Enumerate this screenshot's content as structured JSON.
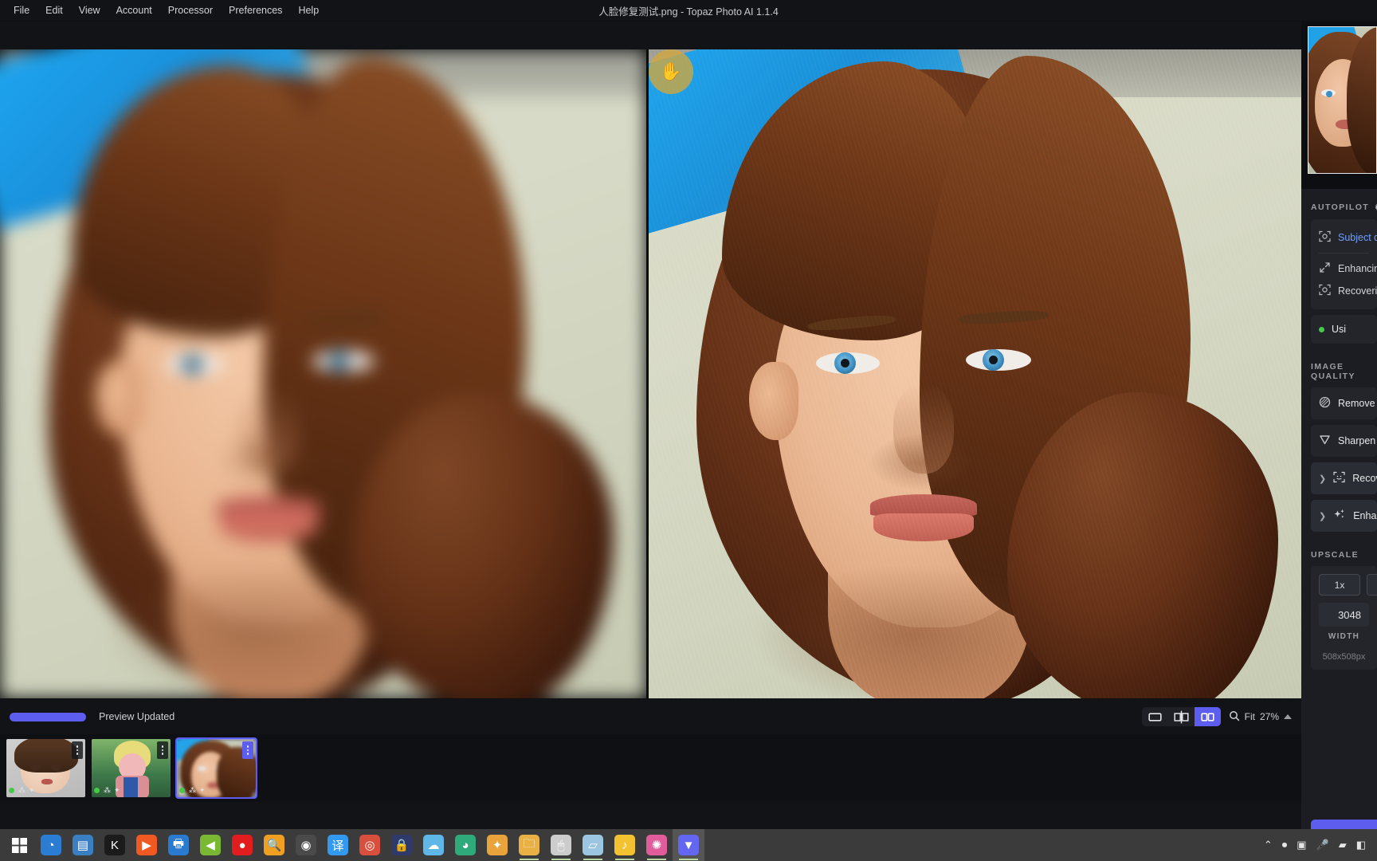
{
  "window": {
    "title": "人脸修复测试.png - Topaz Photo AI 1.1.4",
    "menus": [
      {
        "label": "File"
      },
      {
        "label": "Edit"
      },
      {
        "label": "View"
      },
      {
        "label": "Account"
      },
      {
        "label": "Processor"
      },
      {
        "label": "Preferences"
      },
      {
        "label": "Help"
      }
    ]
  },
  "sidebar": {
    "autopilot": {
      "title": "AUTOPILOT",
      "gear_icon": "gear-icon",
      "rows": [
        {
          "icon": "subject-detect-icon",
          "label": "Subject dete",
          "accent": true
        },
        {
          "icon": "enhance-arrows-icon",
          "label": "Enhancing r",
          "accent": false
        },
        {
          "icon": "face-recover-icon",
          "label": "Recovering",
          "accent": false
        }
      ],
      "status": {
        "dot": "green",
        "label": "Usi"
      }
    },
    "image_quality": {
      "title": "IMAGE QUALITY",
      "items": [
        {
          "icon": "remove-noise-icon",
          "label": "Remove No",
          "expandable": false
        },
        {
          "icon": "sharpen-icon",
          "label": "Sharpen",
          "expandable": false
        },
        {
          "icon": "recover-faces-icon",
          "label": "Recover",
          "expandable": true
        },
        {
          "icon": "enhance-icon",
          "label": "Enhance",
          "expandable": true
        }
      ]
    },
    "upscale": {
      "title": "UPSCALE",
      "scale_buttons": [
        {
          "label": "1x"
        },
        {
          "label": ""
        }
      ],
      "width_value": "3048",
      "width_label": "WIDTH",
      "source_size": "508x508px"
    },
    "save_label": ""
  },
  "statusbar": {
    "progress_label": "Preview Updated",
    "view_modes": [
      {
        "icon": "single-view-icon",
        "active": false
      },
      {
        "icon": "split-view-icon",
        "active": false
      },
      {
        "icon": "side-by-side-icon",
        "active": true
      }
    ],
    "zoom_icon": "magnifier-icon",
    "zoom_fit_label": "Fit",
    "zoom_value": "27%",
    "zoom_caret": "caret-up-icon"
  },
  "filmstrip": {
    "items": [
      {
        "name": "thumbnail-anime-portrait",
        "selected": false,
        "dot": "green"
      },
      {
        "name": "thumbnail-dragonball",
        "selected": false,
        "dot": "green"
      },
      {
        "name": "thumbnail-current-portrait",
        "selected": true,
        "dot": "green"
      }
    ]
  },
  "canvas": {
    "left_pane_name": "original-preview-pane",
    "right_pane_name": "enhanced-preview-pane",
    "cursor_icon": "hand-cursor-icon"
  },
  "taskbar": {
    "start_icon": "windows-start-icon",
    "apps": [
      {
        "name": "edge-icon",
        "glyph": "◔",
        "color": "#2b7cd3",
        "running": false
      },
      {
        "name": "network-monitor-icon",
        "glyph": "▤",
        "color": "#3a7fc1",
        "running": false
      },
      {
        "name": "kugou-icon",
        "glyph": "K",
        "color": "#1b1b1b",
        "running": false
      },
      {
        "name": "video-editor-icon",
        "glyph": "▶",
        "color": "#f05a22",
        "running": false
      },
      {
        "name": "printer-icon",
        "glyph": "🖶",
        "color": "#2a7bd0",
        "running": false
      },
      {
        "name": "green-arrow-icon",
        "glyph": "◀",
        "color": "#7ab733",
        "running": false
      },
      {
        "name": "record-icon",
        "glyph": "●",
        "color": "#e11d1d",
        "running": false
      },
      {
        "name": "search-everything-icon",
        "glyph": "🔍",
        "color": "#f0a020",
        "running": false
      },
      {
        "name": "obs-icon",
        "glyph": "◉",
        "color": "#4a4a4a",
        "running": false
      },
      {
        "name": "translate-icon",
        "glyph": "译",
        "color": "#3399ee",
        "running": false
      },
      {
        "name": "chrome-icon",
        "glyph": "◎",
        "color": "#d94f3d",
        "running": false
      },
      {
        "name": "lock-icon",
        "glyph": "🔒",
        "color": "#2f3a6b",
        "running": false
      },
      {
        "name": "rabbit-assistant-icon",
        "glyph": "☁",
        "color": "#5fb7e8",
        "running": false
      },
      {
        "name": "panda-icon",
        "glyph": "◕",
        "color": "#2faa7a",
        "running": false
      },
      {
        "name": "package-icon",
        "glyph": "✦",
        "color": "#e8a33d",
        "running": false
      },
      {
        "name": "file-explorer-icon",
        "glyph": "🗀",
        "color": "#e8b045",
        "running": true
      },
      {
        "name": "mouse-tool-icon",
        "glyph": "🖱",
        "color": "#cccccc",
        "running": true
      },
      {
        "name": "notes-icon",
        "glyph": "▱",
        "color": "#9bc5e0",
        "running": true
      },
      {
        "name": "netease-music-icon",
        "glyph": "♪",
        "color": "#f2c230",
        "running": true
      },
      {
        "name": "colorful-app-icon",
        "glyph": "✺",
        "color": "#e05c9a",
        "running": true
      },
      {
        "name": "topaz-photo-ai-icon",
        "glyph": "▼",
        "color": "#6366f1",
        "running": true,
        "active": true
      }
    ],
    "tray": [
      {
        "name": "show-hidden-icons-chevron",
        "glyph": "⌃"
      },
      {
        "name": "tray-record-icon",
        "glyph": "⏺"
      },
      {
        "name": "tray-camera-icon",
        "glyph": "▣"
      },
      {
        "name": "tray-mic-icon",
        "glyph": "🎤"
      },
      {
        "name": "tray-network-icon",
        "glyph": "▰"
      },
      {
        "name": "tray-volume-icon",
        "glyph": "◧"
      }
    ]
  }
}
